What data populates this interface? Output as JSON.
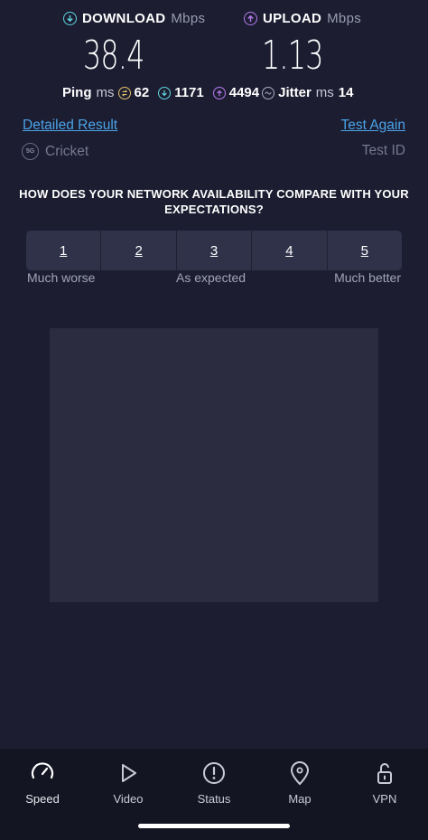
{
  "download": {
    "label": "DOWNLOAD",
    "unit": "Mbps",
    "value": "38.4",
    "color": "#5fd6e0"
  },
  "upload": {
    "label": "UPLOAD",
    "unit": "Mbps",
    "value": "1.13",
    "color": "#b77bf0"
  },
  "stats": {
    "ping_label": "Ping",
    "ping_unit": "ms",
    "ping_idle": "62",
    "ping_download": "1171",
    "ping_upload": "4494",
    "jitter_label": "Jitter",
    "jitter_unit": "ms",
    "jitter_value": "14"
  },
  "links": {
    "detailed_result": "Detailed Result",
    "test_again": "Test Again",
    "color": "#4aa3e8"
  },
  "provider": {
    "badge": "5G",
    "name": "Cricket",
    "test_id_label": "Test ID"
  },
  "survey": {
    "question": "HOW DOES YOUR NETWORK AVAILABILITY COMPARE WITH YOUR EXPECTATIONS?",
    "options": [
      "1",
      "2",
      "3",
      "4",
      "5"
    ],
    "scale_left": "Much worse",
    "scale_mid": "As expected",
    "scale_right": "Much better"
  },
  "tabs": [
    {
      "label": "Speed",
      "icon": "speedometer-icon",
      "active": true
    },
    {
      "label": "Video",
      "icon": "play-icon",
      "active": false
    },
    {
      "label": "Status",
      "icon": "alert-icon",
      "active": false
    },
    {
      "label": "Map",
      "icon": "map-pin-icon",
      "active": false
    },
    {
      "label": "VPN",
      "icon": "unlock-icon",
      "active": false
    }
  ]
}
